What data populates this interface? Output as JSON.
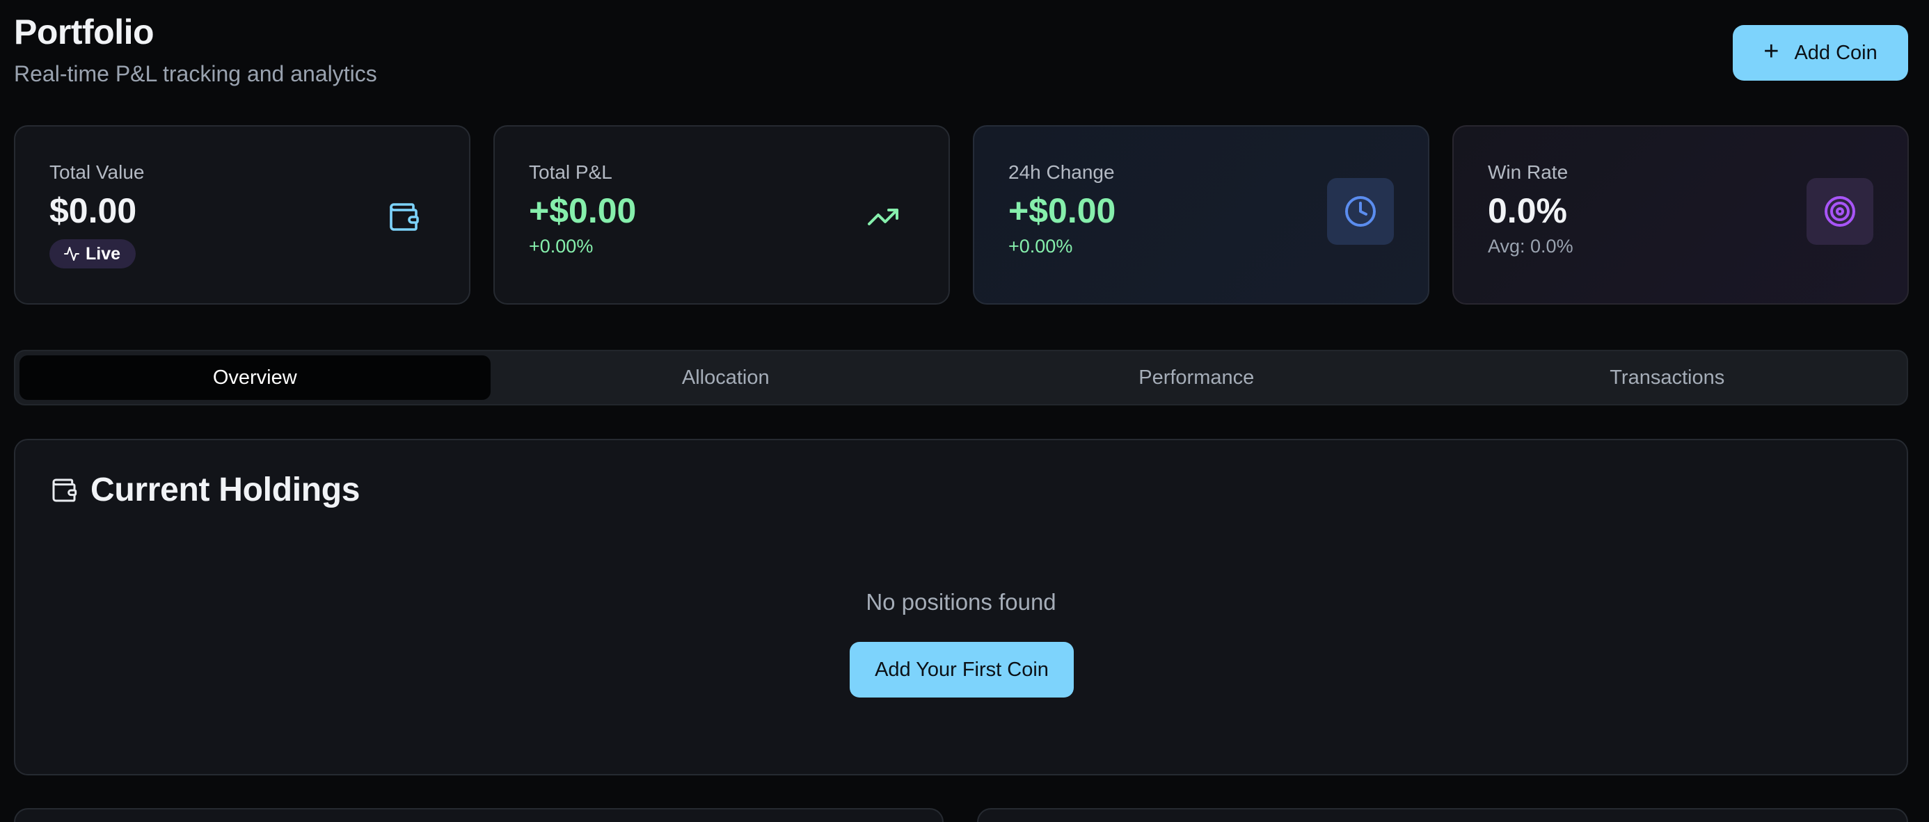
{
  "header": {
    "title": "Portfolio",
    "subtitle": "Real-time P&L tracking and analytics",
    "add_coin_label": "Add Coin"
  },
  "stats": {
    "total_value": {
      "label": "Total Value",
      "value": "$0.00",
      "badge": "Live",
      "icon": "wallet-icon"
    },
    "total_pnl": {
      "label": "Total P&L",
      "value": "+$0.00",
      "change": "+0.00%",
      "icon": "trending-up-icon"
    },
    "change_24h": {
      "label": "24h Change",
      "value": "+$0.00",
      "change": "+0.00%",
      "icon": "clock-icon"
    },
    "win_rate": {
      "label": "Win Rate",
      "value": "0.0%",
      "avg": "Avg: 0.0%",
      "icon": "target-icon"
    }
  },
  "tabs": [
    {
      "label": "Overview",
      "active": true
    },
    {
      "label": "Allocation",
      "active": false
    },
    {
      "label": "Performance",
      "active": false
    },
    {
      "label": "Transactions",
      "active": false
    }
  ],
  "holdings": {
    "title": "Current Holdings",
    "empty_text": "No positions found",
    "cta_label": "Add Your First Coin"
  },
  "colors": {
    "background": "#08090b",
    "accent": "#7dd3fc",
    "positive": "#86efac",
    "clock_icon": "#5b8def",
    "target_icon": "#a855f7"
  }
}
